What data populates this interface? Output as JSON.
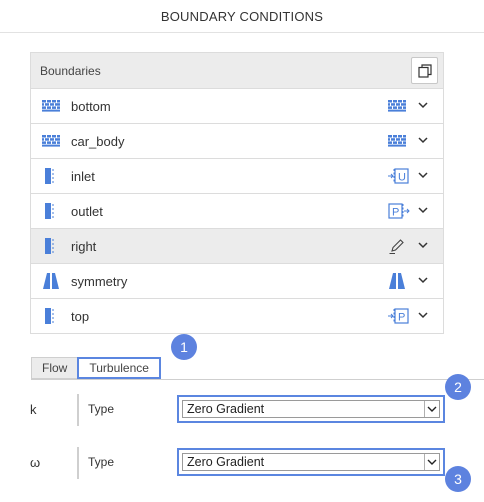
{
  "header": {
    "title": "BOUNDARY CONDITIONS"
  },
  "panel": {
    "title": "Boundaries",
    "rows": [
      {
        "label": "bottom",
        "icon": "wall-grid-icon",
        "type_icon": "wall-grid-icon",
        "selected": false
      },
      {
        "label": "car_body",
        "icon": "wall-grid-icon",
        "type_icon": "wall-grid-icon",
        "selected": false
      },
      {
        "label": "inlet",
        "icon": "patch-icon",
        "type_icon": "velocity-inlet-icon",
        "type_letter": "U",
        "selected": false
      },
      {
        "label": "outlet",
        "icon": "patch-icon",
        "type_icon": "pressure-outlet-icon",
        "type_letter": "P",
        "selected": false
      },
      {
        "label": "right",
        "icon": "patch-icon",
        "type_icon": "pencil-edit-icon",
        "selected": true
      },
      {
        "label": "symmetry",
        "icon": "symmetry-icon",
        "type_icon": "symmetry-icon",
        "selected": false
      },
      {
        "label": "top",
        "icon": "patch-icon",
        "type_icon": "pressure-inlet-icon",
        "type_letter": "P",
        "selected": false
      }
    ]
  },
  "tabs": [
    {
      "label": "Flow",
      "active": false
    },
    {
      "label": "Turbulence",
      "active": true
    }
  ],
  "fields": [
    {
      "symbol": "k",
      "type_label": "Type",
      "value": "Zero Gradient"
    },
    {
      "symbol": "ω",
      "type_label": "Type",
      "value": "Zero Gradient"
    }
  ],
  "badges": [
    "1",
    "2",
    "3"
  ],
  "colors": {
    "accent": "#5b86e0",
    "badge": "#5d82df",
    "icon_blue": "#4a7fd9"
  }
}
